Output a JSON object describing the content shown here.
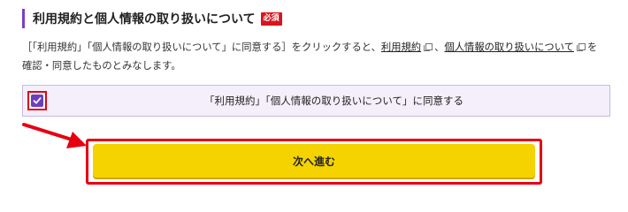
{
  "section": {
    "title": "利用規約と個人情報の取り扱いについて",
    "required_badge": "必須"
  },
  "description": {
    "before": "［「利用規約」「個人情報の取り扱いについて」に同意する］をクリックすると、",
    "terms_link": "利用規約",
    "separator": "、",
    "privacy_link": "個人情報の取り扱いについて",
    "after_privacy": "を",
    "second_line": "確認・同意したものとみなします。"
  },
  "agreement": {
    "checked": true,
    "label": "「利用規約」「個人情報の取り扱いについて」に同意する"
  },
  "next_button": {
    "label": "次へ進む"
  },
  "colors": {
    "accent_purple": "#7b3fc4",
    "highlight_red": "#e60012",
    "button_yellow": "#f5d300",
    "badge_red": "#d8141e"
  },
  "icons": {
    "external_link": "external-link-icon",
    "checkbox": "checkbox-checked-icon",
    "arrow": "red-arrow-icon"
  }
}
